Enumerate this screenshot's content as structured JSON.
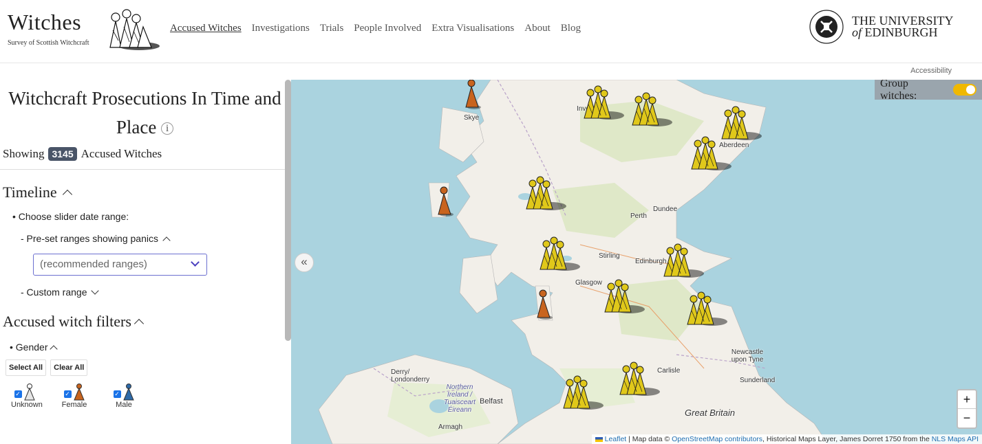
{
  "header": {
    "title": "Witches",
    "subtitle": "Survey of Scottish Witchcraft",
    "nav": [
      "Accused Witches",
      "Investigations",
      "Trials",
      "People Involved",
      "Extra Visualisations",
      "About",
      "Blog"
    ],
    "university_line1": "THE UNIVERSITY",
    "university_of": "of",
    "university_line2": "EDINBURGH",
    "accessibility": "Accessibility"
  },
  "sidebar": {
    "title": "Witchcraft Prosecutions In Time and Place",
    "info_symbol": "i",
    "showing_label": "Showing",
    "count": "3145",
    "count_suffix": "Accused Witches",
    "timeline": {
      "heading": "Timeline",
      "bullet": "• Choose slider date range:",
      "preset_label": "- Pre-set ranges showing panics",
      "preset_select_value": "(recommended ranges)",
      "custom_label": "- Custom range"
    },
    "filters": {
      "heading": "Accused witch filters",
      "gender_label": "• Gender",
      "select_all": "Select All",
      "clear_all": "Clear All",
      "genders": [
        {
          "label": "Unknown",
          "color": "#d9d9d9",
          "checked": true
        },
        {
          "label": "Female",
          "color": "#c8641e",
          "checked": true
        },
        {
          "label": "Male",
          "color": "#2e6aa8",
          "checked": true
        }
      ]
    }
  },
  "map": {
    "group_witches_label": "Group witches:",
    "group_witches_on": true,
    "collapse_symbol": "«",
    "zoom_in": "+",
    "zoom_out": "−",
    "labels": [
      "Skye",
      "Dundee",
      "Perth",
      "Stirling",
      "Edinburgh",
      "Glasgow",
      "Aberdeen",
      "Inverness",
      "Carlisle",
      "Newcastle upon Tyne",
      "Sunderland",
      "Derry/ Londonderry",
      "Northern Ireland / Tuaisceart Éireann",
      "Belfast",
      "Armagh",
      "Great Britain"
    ],
    "attribution": {
      "leaflet": "Leaflet",
      "sep": " | Map data © ",
      "osm": "OpenStreetMap contributors",
      "historic": ", Historical Maps Layer, James Dorret 1750 from the ",
      "nls": "NLS Maps API"
    },
    "colors": {
      "group": "#e0c81a",
      "female": "#c8641e",
      "water": "#aad3df",
      "land": "#f2efe9"
    }
  }
}
